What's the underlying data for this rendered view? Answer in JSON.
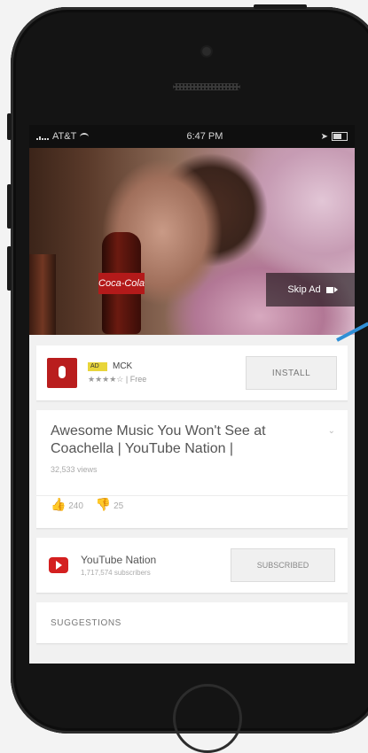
{
  "status_bar": {
    "carrier": "AT&T",
    "time": "6:47 PM"
  },
  "video": {
    "bottle_text": "Coca-Cola",
    "skip_ad_label": "Skip Ad"
  },
  "ad": {
    "badge": "AD",
    "name": "MCK",
    "rating": "★★★★☆",
    "price": "Free",
    "install_label": "INSTALL"
  },
  "video_info": {
    "title": "Awesome Music You Won't See at Coachella | YouTube Nation |",
    "views": "32,533 views",
    "likes": "240",
    "dislikes": "25"
  },
  "channel": {
    "name": "YouTube Nation",
    "subscribers": "1,717,574 subscribers",
    "subscribed_label": "SUBSCRIBED"
  },
  "suggestions_label": "SUGGESTIONS",
  "colors": {
    "accent": "#2f8fd6",
    "youtube_red": "#d42020"
  }
}
